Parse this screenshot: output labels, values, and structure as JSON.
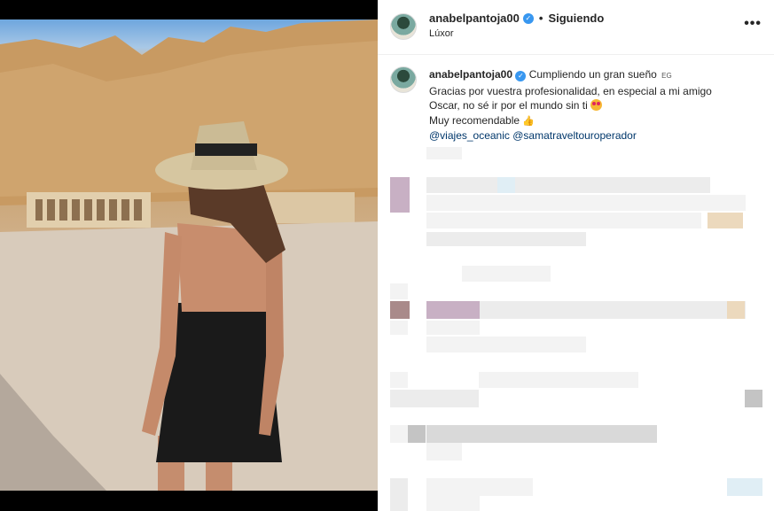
{
  "post": {
    "author": "anabelpantoja00",
    "follow_status": "Siguiendo",
    "separator": "•",
    "location": "Lúxor",
    "more_icon": "more-horizontal-icon",
    "more_label": "•••"
  },
  "caption": {
    "author": "anabelpantoja00",
    "badge": "EG",
    "line1": "Cumpliendo un gran sueño",
    "line2": "Gracias por vuestra profesionalidad, en especial a mi amigo",
    "line3": "Oscar, no sé ir por el mundo sin ti",
    "line4": "Muy recomendable",
    "mention1": "@viajes_oceanic",
    "mention2": "@samatraveltouroperador"
  },
  "icons": {
    "verified": "verified-badge-icon",
    "heart_eyes": "heart-eyes-emoji-icon",
    "thumbs_up": "thumbs-up-emoji-icon"
  },
  "colors": {
    "verified": "#3897f0",
    "mention": "#00376b",
    "text": "#262626"
  }
}
